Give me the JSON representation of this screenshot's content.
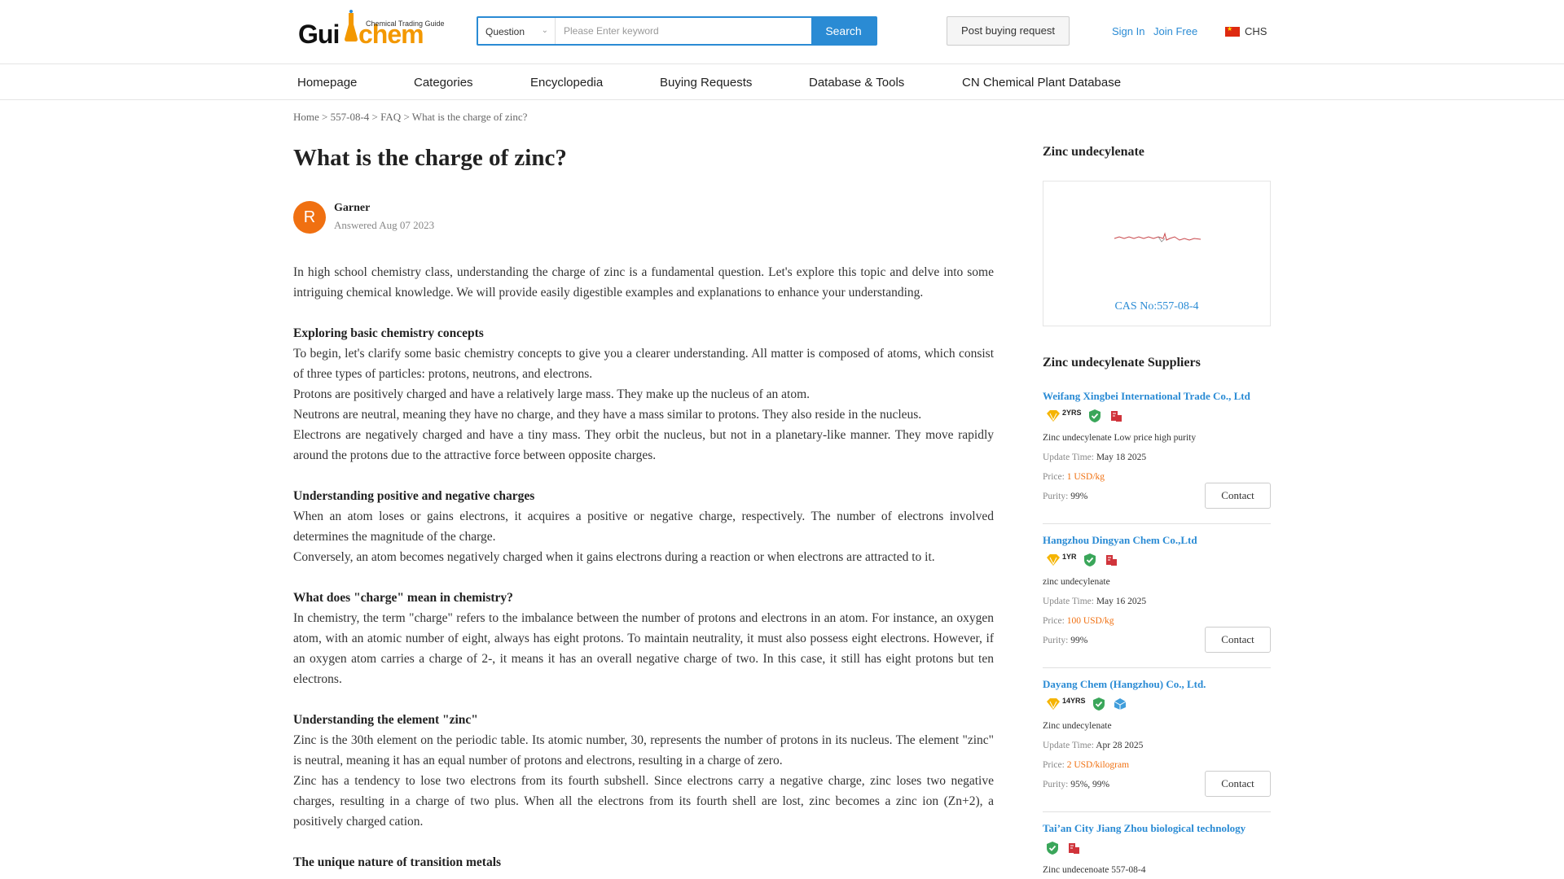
{
  "header": {
    "logo_text_a": "Gui",
    "logo_text_b": "chem",
    "logo_tagline": "Chemical Trading Guide",
    "search_type": "Question",
    "search_placeholder": "Please Enter keyword",
    "search_button": "Search",
    "post_button": "Post buying request",
    "sign_in": "Sign In",
    "join_free": "Join Free",
    "language": "CHS"
  },
  "nav": [
    "Homepage",
    "Categories",
    "Encyclopedia",
    "Buying Requests",
    "Database & Tools",
    "CN Chemical Plant Database"
  ],
  "breadcrumb": {
    "home": "Home",
    "sep1": " > ",
    "cas": "557-08-4",
    "sep2": " > ",
    "faq": "FAQ",
    "sep3": " > ",
    "current": "What is the charge of zinc?"
  },
  "article": {
    "title": "What is the charge of zinc?",
    "avatar_letter": "R",
    "author": "Garner",
    "answered": "Answered Aug 07 2023",
    "intro": "In high school chemistry class, understanding the charge of zinc is a fundamental question. Let's explore this topic and delve into some intriguing chemical knowledge. We will provide easily digestible examples and explanations to enhance your understanding.",
    "h1": "Exploring basic chemistry concepts",
    "p1a": "To begin, let's clarify some basic chemistry concepts to give you a clearer understanding. All matter is composed of atoms, which consist of three types of particles: protons, neutrons, and electrons.",
    "p1b": "Protons are positively charged and have a relatively large mass. They make up the nucleus of an atom.",
    "p1c": "Neutrons are neutral, meaning they have no charge, and they have a mass similar to protons. They also reside in the nucleus.",
    "p1d": "Electrons are negatively charged and have a tiny mass. They orbit the nucleus, but not in a planetary-like manner. They move rapidly around the protons due to the attractive force between opposite charges.",
    "h2": "Understanding positive and negative charges",
    "p2a": "When an atom loses or gains electrons, it acquires a positive or negative charge, respectively. The number of electrons involved determines the magnitude of the charge.",
    "p2b": "Conversely, an atom becomes negatively charged when it gains electrons during a reaction or when electrons are attracted to it.",
    "h3": "What does \"charge\" mean in chemistry?",
    "p3a": "In chemistry, the term \"charge\" refers to the imbalance between the number of protons and electrons in an atom. For instance, an oxygen atom, with an atomic number of eight, always has eight protons. To maintain neutrality, it must also possess eight electrons. However, if an oxygen atom carries a charge of 2-, it means it has an overall negative charge of two. In this case, it still has eight protons but ten electrons.",
    "h4": "Understanding the element \"zinc\"",
    "p4a": "Zinc is the 30th element on the periodic table. Its atomic number, 30, represents the number of protons in its nucleus. The element \"zinc\" is neutral, meaning it has an equal number of protons and electrons, resulting in a charge of zero.",
    "p4b": "Zinc has a tendency to lose two electrons from its fourth subshell. Since electrons carry a negative charge, zinc loses two negative charges, resulting in a charge of two plus. When all the electrons from its fourth shell are lost, zinc becomes a zinc ion (Zn+2), a positively charged cation.",
    "h5": "The unique nature of transition metals"
  },
  "sidebar": {
    "product_title": "Zinc undecylenate",
    "cas_label": "CAS No:557-08-4",
    "suppliers_title": "Zinc undecylenate Suppliers",
    "update_label": "Update Time:",
    "price_label": "Price:",
    "purity_label": "Purity:",
    "contact": "Contact",
    "suppliers": [
      {
        "name": "Weifang Xingbei International Trade Co., Ltd",
        "years": "2YRS",
        "product": "Zinc undecylenate Low price high purity",
        "update": "May 18 2025",
        "price": "1 USD/kg",
        "purity": "99%",
        "third_badge": "red"
      },
      {
        "name": "Hangzhou Dingyan Chem Co.,Ltd",
        "years": "1YR",
        "product": "zinc undecylenate",
        "update": "May 16 2025",
        "price": "100 USD/kg",
        "purity": "99%",
        "third_badge": "red"
      },
      {
        "name": "Dayang Chem (Hangzhou) Co., Ltd.",
        "years": "14YRS",
        "product": "Zinc undecylenate",
        "update": "Apr 28 2025",
        "price": "2 USD/kilogram",
        "purity": "95%, 99%",
        "third_badge": "blue"
      },
      {
        "name": "Tai’an City Jiang Zhou biological technology",
        "years": "",
        "product": "Zinc undecenoate 557-08-4",
        "third_badge": "red"
      }
    ]
  },
  "colors": {
    "accent_blue": "#2a8bd4",
    "orange": "#f07011",
    "gold": "#f5b400",
    "shield_green": "#3aa65a"
  }
}
